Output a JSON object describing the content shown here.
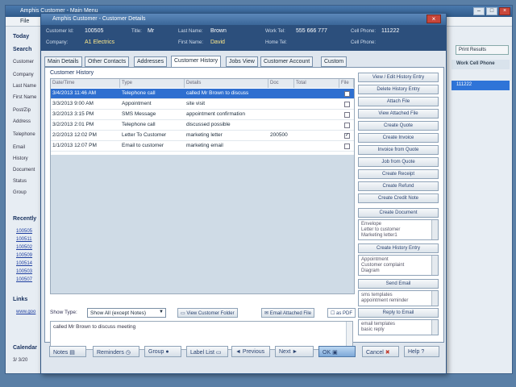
{
  "colors": {
    "accent": "#2e6fd0",
    "header_band": "#2c4f7c",
    "title_bar": "#3a6698",
    "close": "#c8463a"
  },
  "bg_window": {
    "title": "Amphis Customer - Main Menu",
    "menu_file": "File",
    "left": {
      "today": "Today",
      "search": "Search",
      "labels": [
        "Customer",
        "Company",
        "Last Name",
        "First Name",
        "Post/Zip",
        "Address",
        "Telephone",
        "Email",
        "History",
        "Document",
        "Status",
        "Group"
      ],
      "recently": "Recently",
      "recent_items": [
        "100505",
        "100511",
        "100502",
        "100509",
        "100514",
        "100503",
        "100507"
      ],
      "links": "Links",
      "link_item": "www.goo",
      "calendar": "Calendar",
      "calendar_date": "3/ 3/20"
    },
    "print_results": "Print Results",
    "work_cell_phone": "Work Cell Phone",
    "work_cell_value": "111222"
  },
  "dialog": {
    "title": "Amphis Customer - Customer Details",
    "header": {
      "customer_id_label": "Customer Id:",
      "customer_id": "100505",
      "title_label": "Title:",
      "title": "Mr",
      "last_name_label": "Last Name:",
      "last_name": "Brown",
      "work_tel_label": "Work Tel:",
      "work_tel": "555 666 777",
      "cell_phone_label": "Cell Phone:",
      "cell_phone": "111222",
      "company_label": "Company:",
      "company": "A1 Electrics",
      "first_name_label": "First Name:",
      "first_name": "David",
      "home_tel_label": "Home Tel:",
      "cell_phone2_label": "Cell Phone:"
    },
    "tabs": [
      "Main Details",
      "Other Contacts",
      "Addresses",
      "Customer History",
      "Jobs View",
      "Customer Account",
      "Custom"
    ],
    "active_tab": 3,
    "section_label": "Customer History",
    "columns": [
      "Date/Time",
      "Type",
      "Details",
      "Doc",
      "Total",
      "File"
    ],
    "rows": [
      {
        "date": "3/4/2013 11:46 AM",
        "type": "Telephone call",
        "details": "called Mr Brown to discuss",
        "doc": "",
        "file": "",
        "selected": true
      },
      {
        "date": "3/3/2013 9:00 AM",
        "type": "Appointment",
        "details": "site visit",
        "doc": "",
        "file": "",
        "selected": false
      },
      {
        "date": "3/2/2013 3:15 PM",
        "type": "SMS Message",
        "details": "appointment confirmation",
        "doc": "",
        "file": "",
        "selected": false
      },
      {
        "date": "3/2/2013 2:01 PM",
        "type": "Telephone call",
        "details": "discussed possible",
        "doc": "",
        "file": "",
        "selected": false
      },
      {
        "date": "2/2/2013 12:02 PM",
        "type": "Letter To Customer",
        "details": "marketing letter",
        "doc": "200500",
        "file": "✓",
        "selected": false
      },
      {
        "date": "1/1/2013 12:07 PM",
        "type": "Email to customer",
        "details": "marketing email",
        "doc": "",
        "file": "",
        "selected": false
      }
    ],
    "side_buttons": {
      "view_edit": "View / Edit History Entry",
      "delete": "Delete History Entry",
      "attach": "Attach File",
      "view_attached": "View Attached File",
      "create_quote": "Create Quote",
      "create_invoice": "Create Invoice",
      "invoice_from_quote": "Invoice from Quote",
      "job_from_quote": "Job from Quote",
      "create_receipt": "Create Receipt",
      "create_refund": "Create Refund",
      "create_credit": "Create Credit Note",
      "create_document": "Create Document",
      "create_history": "Create History Entry",
      "send_email": "Send Email",
      "reply_to_email": "Reply to Email"
    },
    "side_boxes": {
      "doc_templates": [
        "Envelope",
        "Letter to customer",
        "Marketing letter1"
      ],
      "history_templates": [
        "Appointment",
        "Customer complaint",
        "Diagram"
      ],
      "sms_templates": [
        "sms templates",
        "appointment reminder"
      ],
      "email_templates": [
        "email templates",
        "basic reply"
      ]
    },
    "show_type_label": "Show Type:",
    "show_type_value": "Show All (except Notes)",
    "view_customer_folder": "View Customer Folder",
    "email_attached_file": "Email Attached File",
    "as_pdf": "as PDF",
    "notes_text": "called Mr Brown to discuss meeting",
    "bottom_buttons": {
      "notes": "Notes",
      "reminders": "Reminders",
      "group": "Group",
      "label_list": "Label List",
      "previous": "◄ Previous",
      "next": "Next ►",
      "ok": "OK",
      "cancel": "Cancel",
      "help": "Help"
    }
  }
}
